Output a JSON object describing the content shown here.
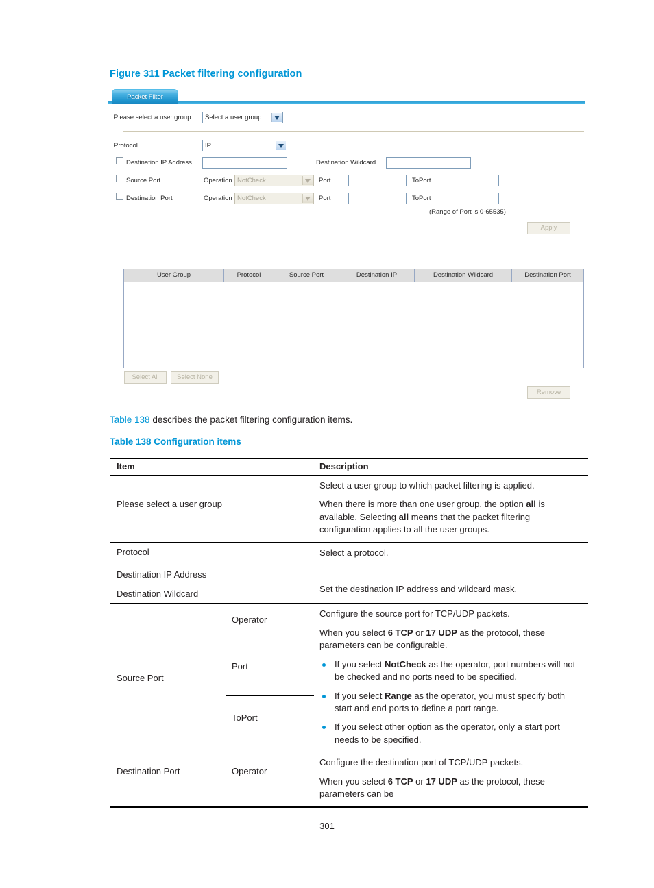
{
  "figure": {
    "caption": "Figure 311 Packet filtering configuration",
    "tab_label": "Packet Filter",
    "user_group_label": "Please select a user group",
    "user_group_value": "Select a user group",
    "protocol_label": "Protocol",
    "protocol_value": "IP",
    "dest_ip_label": "Destination IP Address",
    "dest_ip_value": "",
    "dest_wildcard_label": "Destination Wildcard",
    "dest_wildcard_value": "",
    "source_port_label": "Source Port",
    "dest_port_label": "Destination Port",
    "operation_label": "Operation",
    "operation_value": "NotCheck",
    "port_label": "Port",
    "toport_label": "ToPort",
    "src_port_value": "",
    "src_toport_value": "",
    "dst_port_value": "",
    "dst_toport_value": "",
    "range_hint": "(Range of Port is 0-65535)",
    "apply_label": "Apply",
    "select_all_label": "Select All",
    "select_none_label": "Select None",
    "remove_label": "Remove",
    "grid_headers": [
      "User Group",
      "Protocol",
      "Source Port",
      "Destination IP",
      "Destination Wildcard",
      "Destination Port"
    ],
    "grid_rows": [],
    "colors": {
      "tab_blue": "#1f94cd",
      "rail_blue": "#44b6e6",
      "accent": "#0096d6"
    }
  },
  "body": {
    "intro_link": "Table 138",
    "intro_rest": " describes the packet filtering configuration items.",
    "table_caption": "Table 138 Configuration items"
  },
  "doc_table": {
    "headers": {
      "item": "Item",
      "description": "Description"
    },
    "rows": {
      "user_group": {
        "item": "Please select a user group",
        "p1": "Select a user group to which packet filtering is applied.",
        "p2_a": "When there is more than one user group, the option ",
        "p2_b": "all",
        "p2_c": " is available. Selecting ",
        "p2_d": "all",
        "p2_e": " means that the packet filtering configuration applies to all the user groups."
      },
      "protocol": {
        "item": "Protocol",
        "desc": "Select a protocol."
      },
      "dest_ip": {
        "item": "Destination IP Address"
      },
      "dest_wildcard": {
        "item": "Destination Wildcard",
        "desc": "Set the destination IP address and wildcard mask."
      },
      "source_port": {
        "item": "Source Port",
        "sub_operator": "Operator",
        "sub_port": "Port",
        "sub_toport": "ToPort",
        "p1": "Configure the source port for TCP/UDP packets.",
        "p2_a": "When you select ",
        "p2_b": "6 TCP",
        "p2_c": " or ",
        "p2_d": "17 UDP",
        "p2_e": " as the protocol, these parameters can be configurable.",
        "b1_a": "If you select ",
        "b1_b": "NotCheck",
        "b1_c": " as the operator, port numbers will not be checked and no ports need to be specified.",
        "b2_a": "If you select ",
        "b2_b": "Range",
        "b2_c": " as the operator, you must specify both start and end ports to define a port range.",
        "b3": "If you select other option as the operator, only a start port needs to be specified."
      },
      "dest_port": {
        "item": "Destination Port",
        "sub_operator": "Operator",
        "p1": "Configure the destination port of TCP/UDP packets.",
        "p2_a": "When you select ",
        "p2_b": "6 TCP",
        "p2_c": " or ",
        "p2_d": "17 UDP",
        "p2_e": " as the protocol, these parameters can be"
      }
    }
  },
  "footer": {
    "page_number": "301"
  }
}
